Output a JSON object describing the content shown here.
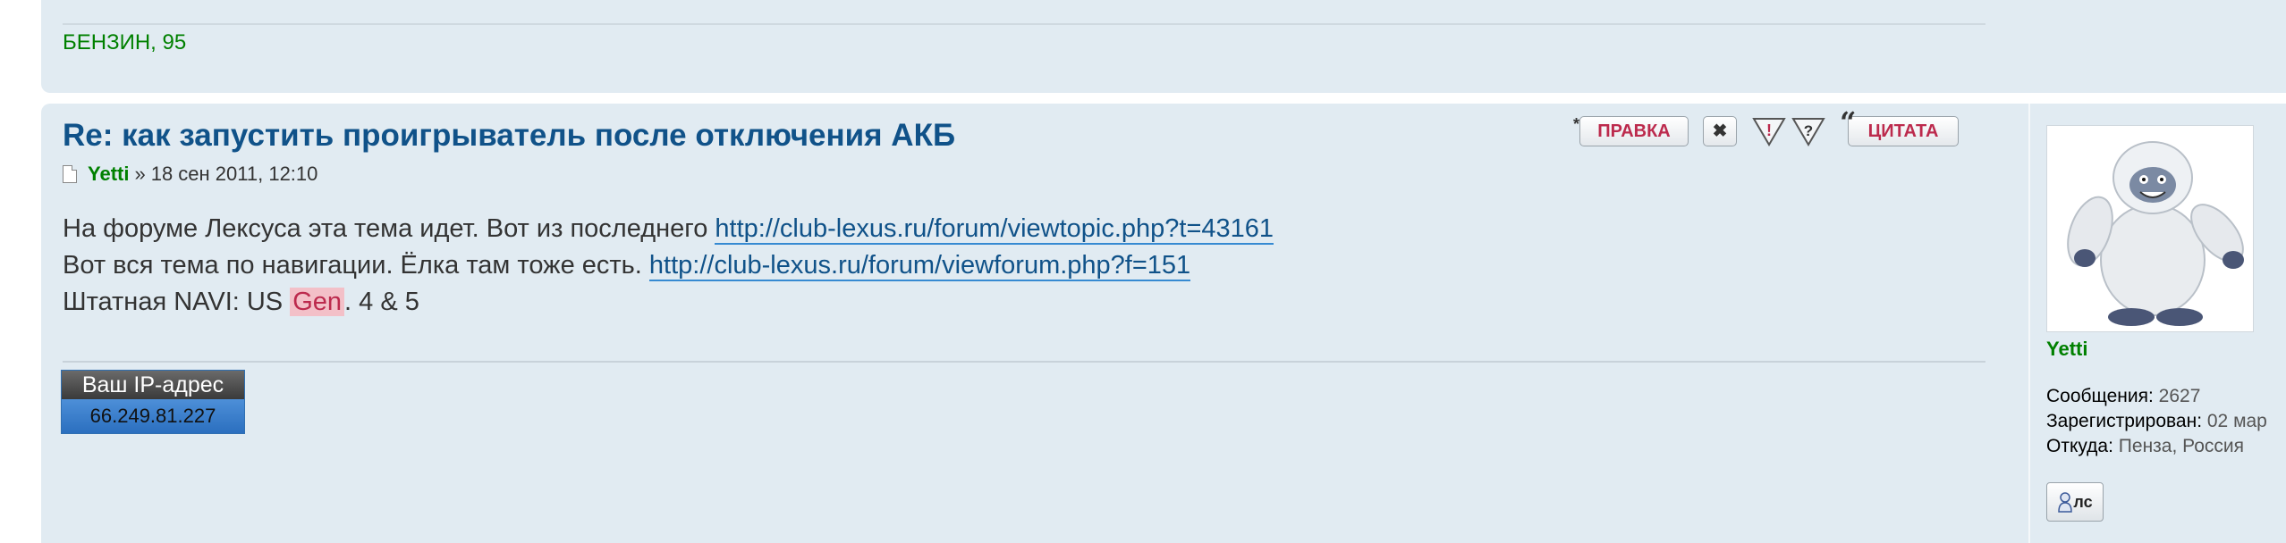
{
  "prev_post": {
    "signature": "БЕНЗИН, 95"
  },
  "post": {
    "title": "Re: как запустить проигрыватель после отключения АКБ",
    "author": "Yetti",
    "date_sep": "»",
    "date": "18 сен 2011, 12:10",
    "content": {
      "line1_text": "На форуме Лексуса эта тема идет. Вот из последнего ",
      "line1_link": "http://club-lexus.ru/forum/viewtopic.php?t=43161",
      "line2_text": "Вот вся тема по навигации. Ёлка там тоже есть. ",
      "line2_link": "http://club-lexus.ru/forum/viewforum.php?f=151",
      "line3_prefix": "Штатная NAVI: US ",
      "line3_highlight": "Gen",
      "line3_suffix": ". 4 & 5"
    },
    "ip_widget": {
      "label": "Ваш IP-адрес",
      "value": "66.249.81.227"
    },
    "buttons": {
      "edit": "ПРАВКА",
      "quote": "ЦИТАТА"
    }
  },
  "profile": {
    "username": "Yetti",
    "posts_label": "Сообщения:",
    "posts_value": "2627",
    "registered_label": "Зарегистрирован:",
    "registered_value": "02 мар",
    "from_label": "Откуда:",
    "from_value": "Пенза, Россия",
    "pm_label": "лс"
  }
}
